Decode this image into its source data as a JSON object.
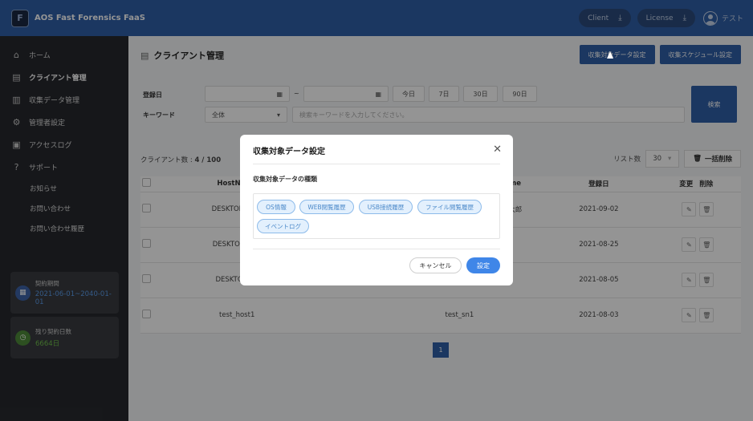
{
  "header": {
    "title": "AOS Fast Forensics FaaS",
    "client_btn": "Client",
    "license_btn": "License",
    "user_name": "テスト"
  },
  "sidebar": {
    "items": [
      {
        "label": "ホーム",
        "icon": "home-icon"
      },
      {
        "label": "クライアント管理",
        "icon": "building-icon"
      },
      {
        "label": "収集データ管理",
        "icon": "chart-icon"
      },
      {
        "label": "管理者設定",
        "icon": "gear-icon"
      },
      {
        "label": "アクセスログ",
        "icon": "log-icon"
      },
      {
        "label": "サポート",
        "icon": "help-icon"
      }
    ],
    "sub_items": [
      "お知らせ",
      "お問い合わせ",
      "お問い合わせ履歴"
    ],
    "contract": {
      "label": "契約期間",
      "value": "2021-06-01~2040-01-01"
    },
    "remaining": {
      "label": "残り契約日数",
      "value": "6664日"
    }
  },
  "main": {
    "page_title": "クライアント管理",
    "btn_collect_setting": "収集対象データ設定",
    "btn_schedule_setting": "収集スケジュール設定",
    "filters": {
      "date_label": "登録日",
      "range_sep": "~",
      "btn_today": "今日",
      "btn_7": "7日",
      "btn_30": "30日",
      "btn_90": "90日",
      "keyword_label": "キーワード",
      "scope_value": "全体",
      "search_placeholder": "検索キーワードを入力してください。",
      "search_btn": "検索"
    },
    "count_label": "クライアント数 : ",
    "count_value": "4 / 100",
    "list_label": "リスト数",
    "list_value": "30",
    "bulk_delete": "一括削除",
    "columns": [
      "HostName",
      "rName",
      "登録日",
      "変更",
      "削除"
    ],
    "rows": [
      {
        "host": "DESKTOP-SPT1",
        "user": "ガル太郎",
        "date": "2021-09-02"
      },
      {
        "host": "DESKTOP-V5IK",
        "user": "",
        "date": "2021-08-25"
      },
      {
        "host": "DESKTOP-SC",
        "user": "",
        "date": "2021-08-05"
      },
      {
        "host": "test_host1",
        "user": "test_sn1",
        "date": "2021-08-03"
      }
    ],
    "page": "1"
  },
  "modal": {
    "title": "収集対象データ設定",
    "section_label": "収集対象データの種類",
    "tags": [
      "OS情報",
      "WEB閲覧履歴",
      "USB接続履歴",
      "ファイル閲覧履歴",
      "イベントログ"
    ],
    "cancel": "キャンセル",
    "ok": "設定"
  },
  "colors": {
    "primary": "#2f5fa8",
    "sidebar": "#27292e",
    "accent": "#3f86e8",
    "contract_value": "#5b9be8",
    "remaining_value": "#6fbf4a"
  }
}
